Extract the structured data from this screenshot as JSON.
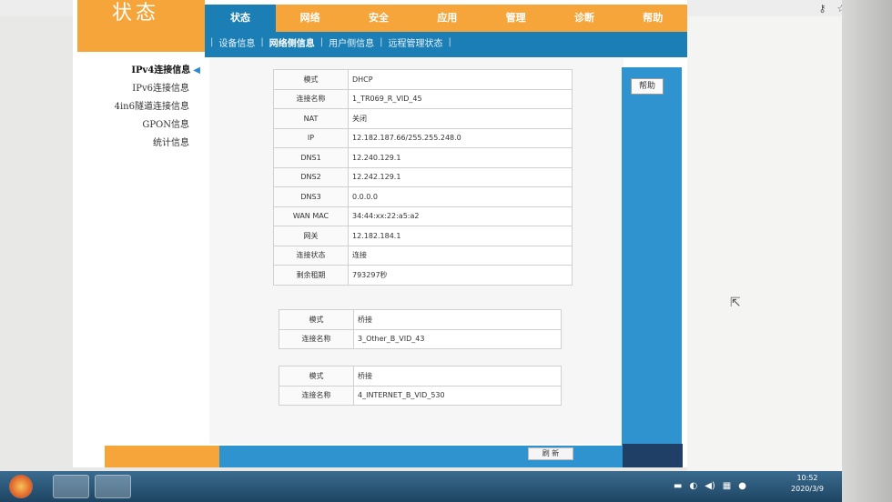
{
  "browser": {
    "key_icon": "key-icon",
    "star_icon": "star-icon",
    "account_icon": "account-icon",
    "menu_icon": "menu-icon"
  },
  "header": {
    "logo_text": "状态",
    "nav": [
      "状态",
      "网络",
      "安全",
      "应用",
      "管理",
      "诊断",
      "帮助"
    ],
    "subnav": [
      "设备信息",
      "网络侧信息",
      "用户侧信息",
      "远程管理状态"
    ]
  },
  "sidebar": {
    "items": [
      "IPv4连接信息",
      "IPv6连接信息",
      "4in6隧道连接信息",
      "GPON信息",
      "统计信息"
    ]
  },
  "connection1": [
    {
      "k": "模式",
      "v": "DHCP"
    },
    {
      "k": "连接名称",
      "v": "1_TR069_R_VID_45"
    },
    {
      "k": "NAT",
      "v": "关闭"
    },
    {
      "k": "IP",
      "v": "12.182.187.66/255.255.248.0"
    },
    {
      "k": "DNS1",
      "v": "12.240.129.1"
    },
    {
      "k": "DNS2",
      "v": "12.242.129.1"
    },
    {
      "k": "DNS3",
      "v": "0.0.0.0"
    },
    {
      "k": "WAN MAC",
      "v": "34:44:xx:22:a5:a2"
    },
    {
      "k": "网关",
      "v": "12.182.184.1"
    },
    {
      "k": "连接状态",
      "v": "连接"
    },
    {
      "k": "剩余租期",
      "v": "793297秒"
    }
  ],
  "connection2": [
    {
      "k": "模式",
      "v": "桥接"
    },
    {
      "k": "连接名称",
      "v": "3_Other_B_VID_43"
    }
  ],
  "connection3": [
    {
      "k": "模式",
      "v": "桥接"
    },
    {
      "k": "连接名称",
      "v": "4_INTERNET_B_VID_530"
    }
  ],
  "help_label": "帮助",
  "refresh_label": "刷 新",
  "taskbar": {
    "time": "10:52",
    "date": "2020/3/9"
  }
}
